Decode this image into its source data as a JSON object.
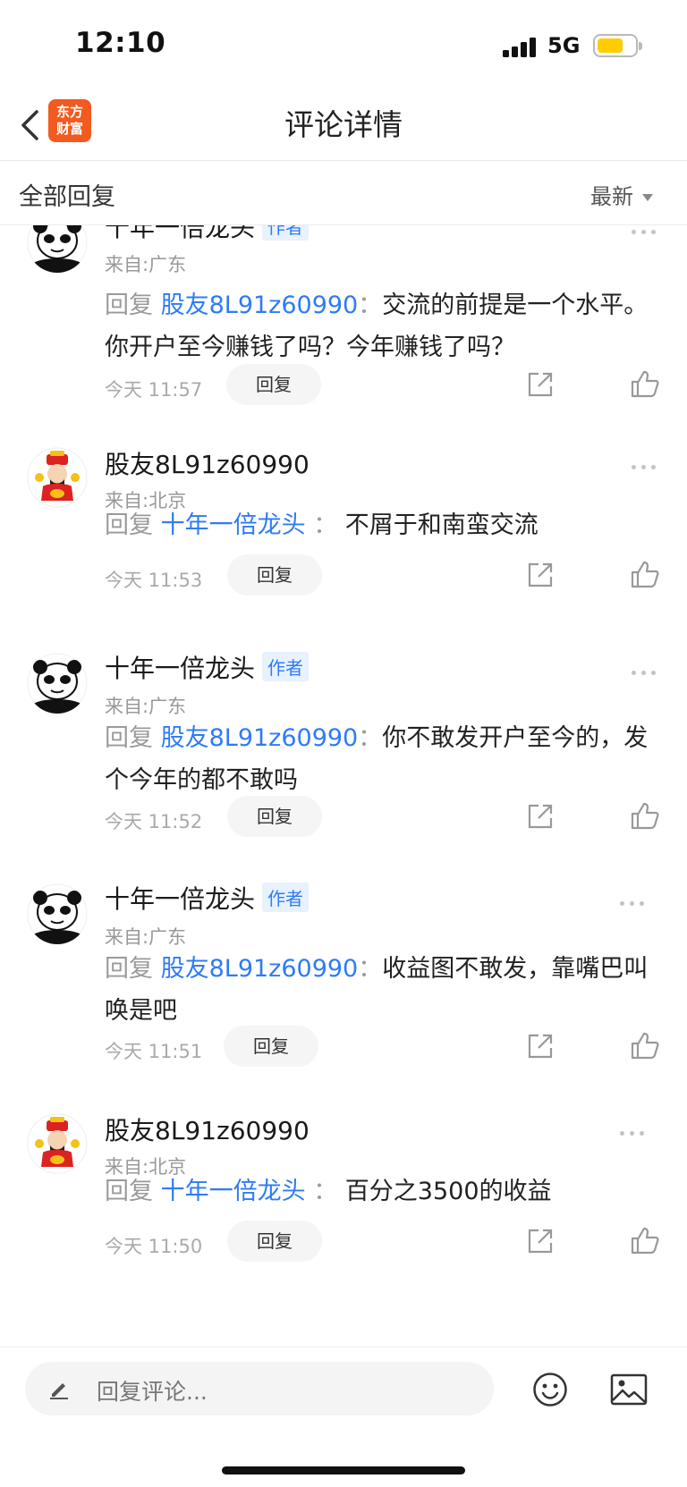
{
  "status_bar": {
    "time": "12:10",
    "network": "5G"
  },
  "nav": {
    "title": "评论详情",
    "logo_line1": "东方",
    "logo_line2": "财富"
  },
  "section": {
    "title": "全部回复",
    "sort_label": "最新"
  },
  "comments": [
    {
      "username": "十年一倍龙头",
      "badge": "作者",
      "location": "来自:广东",
      "reply_word": "回复",
      "reply_to": "股友8L91z60990",
      "colon": "：",
      "text": "交流的前提是一个水平。你开户至今赚钱了吗？今年赚钱了吗？",
      "time": "今天 11:57",
      "reply_label": "回复",
      "avatar": "panda-meme"
    },
    {
      "username": "股友8L91z60990",
      "badge": "",
      "location": "来自:北京",
      "reply_word": "回复",
      "reply_to": "十年一倍龙头",
      "colon": "：",
      "text": "不屑于和南蛮交流",
      "time": "今天 11:53",
      "reply_label": "回复",
      "avatar": "fortune-god"
    },
    {
      "username": "十年一倍龙头",
      "badge": "作者",
      "location": "来自:广东",
      "reply_word": "回复",
      "reply_to": "股友8L91z60990",
      "colon": "：",
      "text": "你不敢发开户至今的，发个今年的都不敢吗",
      "time": "今天 11:52",
      "reply_label": "回复",
      "avatar": "panda-meme"
    },
    {
      "username": "十年一倍龙头",
      "badge": "作者",
      "location": "来自:广东",
      "reply_word": "回复",
      "reply_to": "股友8L91z60990",
      "colon": "：",
      "text": "收益图不敢发，靠嘴巴叫唤是吧",
      "time": "今天 11:51",
      "reply_label": "回复",
      "avatar": "panda-meme"
    },
    {
      "username": "股友8L91z60990",
      "badge": "",
      "location": "来自:北京",
      "reply_word": "回复",
      "reply_to": "十年一倍龙头",
      "colon": "：",
      "text": "百分之3500的收益",
      "time": "今天 11:50",
      "reply_label": "回复",
      "avatar": "fortune-god"
    }
  ],
  "input_bar": {
    "placeholder": "回复评论..."
  },
  "colors": {
    "accent": "#2f7bf5",
    "brand": "#f25a1f",
    "battery": "#ffcc00"
  }
}
